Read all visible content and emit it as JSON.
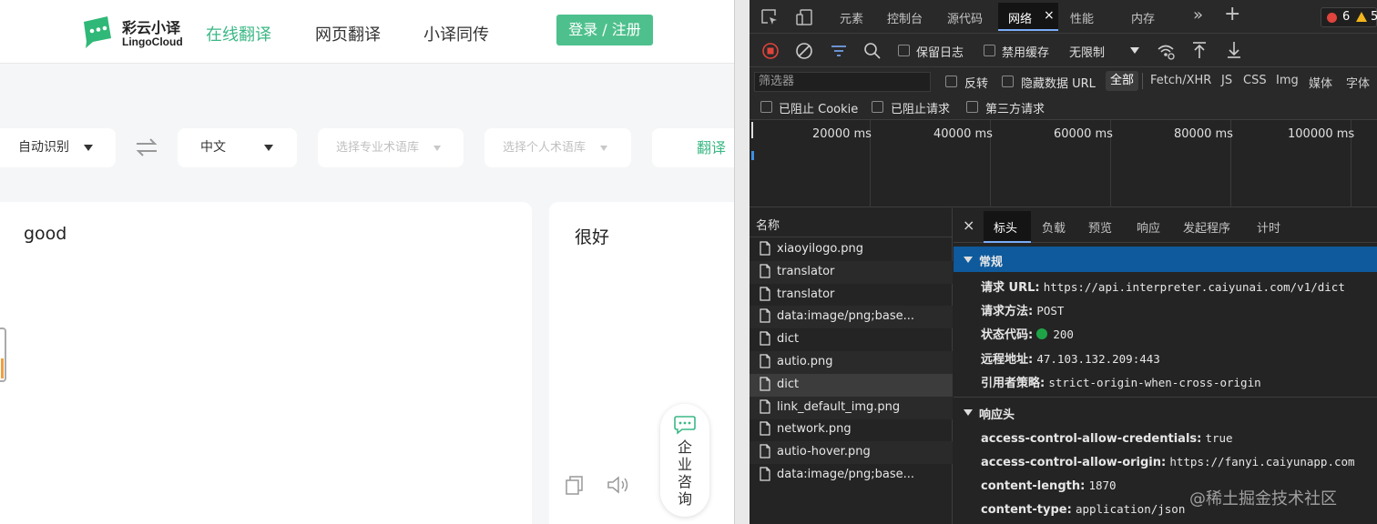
{
  "app": {
    "logo": {
      "name": "彩云小译",
      "subtitle": "LingoCloud"
    },
    "nav": [
      "在线翻译",
      "网页翻译",
      "小译同传"
    ],
    "login_label": "登录 / 注册",
    "source_lang": "自动识别",
    "target_lang": "中文",
    "pro_glossary_placeholder": "选择专业术语库",
    "personal_glossary_placeholder": "选择个人术语库",
    "translate_label": "翻译",
    "source_text": "good",
    "target_text": "很好",
    "consult_label": "企业咨询",
    "colors": {
      "brand": "#3cb886",
      "button": "#4ec08d"
    }
  },
  "devtools": {
    "tabs": [
      "元素",
      "控制台",
      "源代码",
      "网络",
      "性能",
      "内存"
    ],
    "active_tab": "网络",
    "close_glyph": "×",
    "more_glyph": "»",
    "add_glyph": "+",
    "error_count": "6",
    "warning_count": "5",
    "toolbar": {
      "preserve_log": "保留日志",
      "disable_cache": "禁用缓存",
      "throttle": "无限制"
    },
    "filter": {
      "placeholder": "筛选器",
      "invert": "反转",
      "hide_data_urls": "隐藏数据 URL",
      "types": [
        "全部",
        "Fetch/XHR",
        "JS",
        "CSS",
        "Img",
        "媒体",
        "字体"
      ],
      "blocked_cookies": "已阻止 Cookie",
      "blocked_requests": "已阻止请求",
      "third_party": "第三方请求"
    },
    "timeline_ticks": [
      "20000 ms",
      "40000 ms",
      "60000 ms",
      "80000 ms",
      "100000 ms"
    ],
    "names_header": "名称",
    "requests": [
      "xiaoyilogo.png",
      "translator",
      "translator",
      "data:image/png;base...",
      "dict",
      "autio.png",
      "dict",
      "link_default_img.png",
      "network.png",
      "autio-hover.png",
      "data:image/png;base..."
    ],
    "selected_request_index": 6,
    "detail_tabs": [
      "标头",
      "负载",
      "预览",
      "响应",
      "发起程序",
      "计时"
    ],
    "general": {
      "title": "常规",
      "rows": [
        {
          "k": "请求 URL:",
          "v": "https://api.interpreter.caiyunai.com/v1/dict"
        },
        {
          "k": "请求方法:",
          "v": "POST"
        },
        {
          "k": "状态代码:",
          "v": "200"
        },
        {
          "k": "远程地址:",
          "v": "47.103.132.209:443"
        },
        {
          "k": "引用者策略:",
          "v": "strict-origin-when-cross-origin"
        }
      ]
    },
    "response_headers": {
      "title": "响应头",
      "rows": [
        {
          "k": "access-control-allow-credentials:",
          "v": "true"
        },
        {
          "k": "access-control-allow-origin:",
          "v": "https://fanyi.caiyunapp.com"
        },
        {
          "k": "content-length:",
          "v": "1870"
        },
        {
          "k": "content-type:",
          "v": "application/json"
        }
      ]
    },
    "colors": {
      "accent": "#7cacf8",
      "section_header_bg": "#0e5a9c",
      "status_ok": "#1ea446"
    }
  },
  "watermark": "@稀土掘金技术社区"
}
